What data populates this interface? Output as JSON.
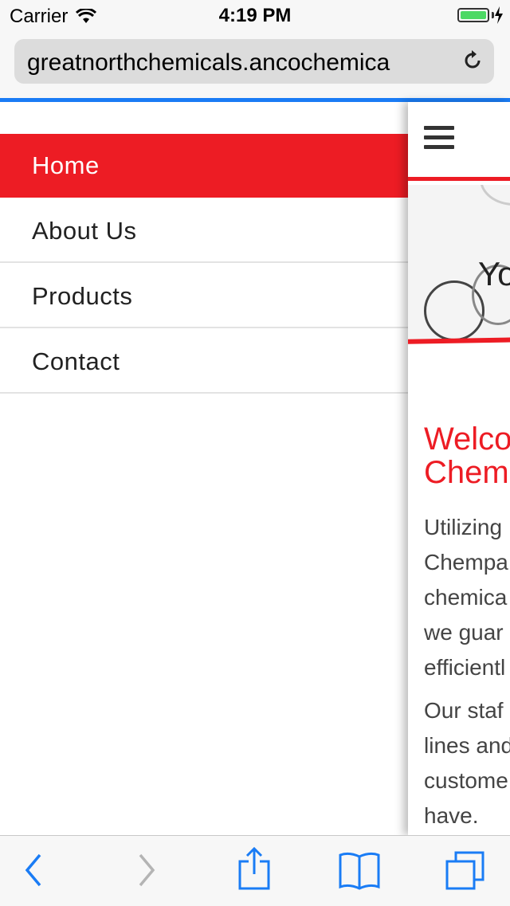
{
  "status": {
    "carrier": "Carrier",
    "time": "4:19 PM"
  },
  "browser": {
    "url": "greatnorthchemicals.ancochemica"
  },
  "menu": {
    "items": [
      {
        "label": "Home"
      },
      {
        "label": "About Us"
      },
      {
        "label": "Products"
      },
      {
        "label": "Contact"
      }
    ]
  },
  "content": {
    "hero_text": "Yo",
    "welcome_line1": "Welco",
    "welcome_line2": "Chem",
    "para1": [
      "Utilizing",
      "Chempa",
      "chemica",
      "we guar",
      "efficientl"
    ],
    "para2": [
      "Our staf",
      "lines and",
      "custome",
      "have."
    ]
  },
  "colors": {
    "accent": "#ed1c24",
    "ios_blue": "#1a7cf5"
  },
  "icons": [
    "wifi-icon",
    "battery-icon",
    "charging-icon",
    "reload-icon",
    "hamburger-menu-icon",
    "back-icon",
    "forward-icon",
    "share-icon",
    "bookmarks-icon",
    "tabs-icon"
  ]
}
